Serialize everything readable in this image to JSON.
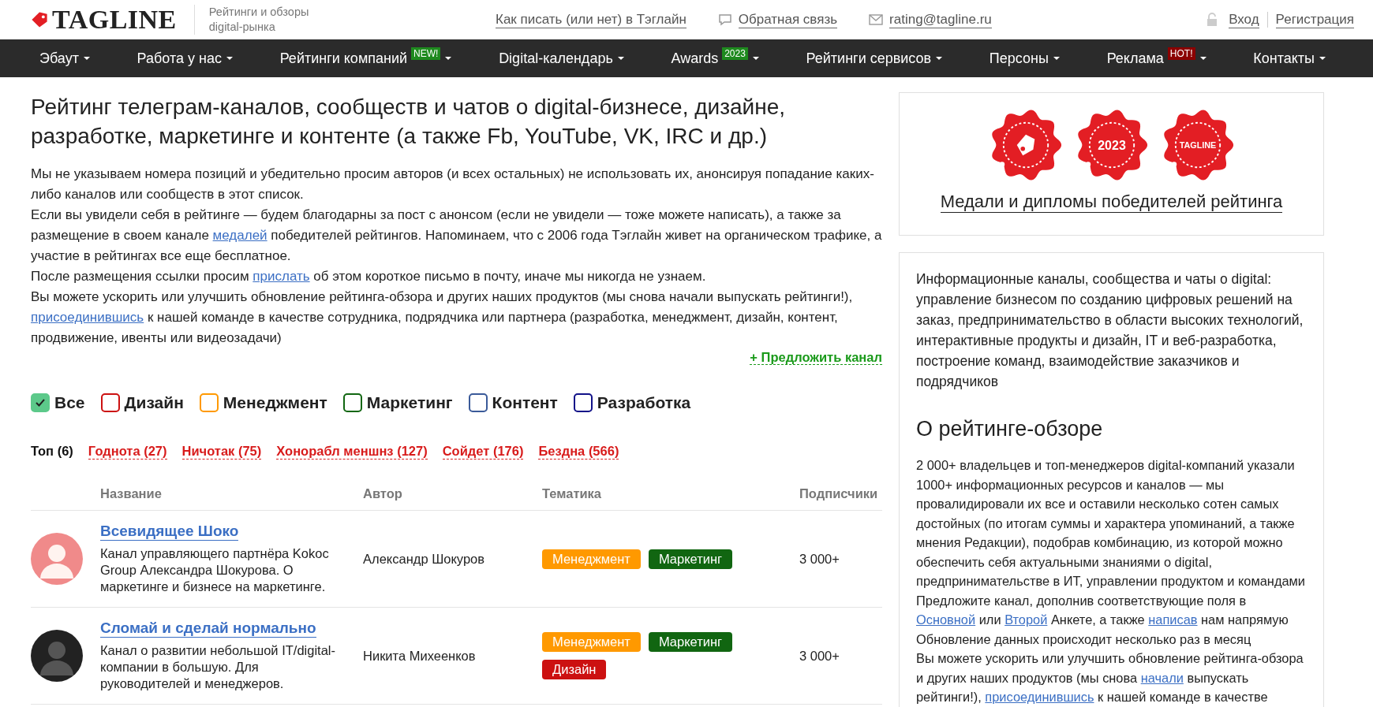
{
  "header": {
    "logo": "TAGLINE",
    "tagline": [
      "Рейтинги и обзоры",
      "digital-рынка"
    ],
    "links": [
      {
        "kind": "plain",
        "label": "Как писать (или нет) в Тэглайн"
      },
      {
        "kind": "chat",
        "label": "Обратная связь"
      },
      {
        "kind": "mail",
        "label": "rating@tagline.ru"
      }
    ],
    "login": "Вход",
    "register": "Регистрация"
  },
  "nav": [
    {
      "label": "Эбаут"
    },
    {
      "label": "Работа у нас"
    },
    {
      "label": "Рейтинги компаний",
      "badge": "NEW!",
      "color": "#1e8a1e"
    },
    {
      "label": "Digital-календарь"
    },
    {
      "label": "Awards",
      "badge": "2023",
      "color": "#1e8a1e"
    },
    {
      "label": "Рейтинги сервисов"
    },
    {
      "label": "Персоны"
    },
    {
      "label": "Реклама",
      "badge": "HOT!",
      "color": "#8b0000"
    },
    {
      "label": "Контакты"
    }
  ],
  "title": "Рейтинг телеграм-каналов, сообществ и чатов о digital-бизнесе, дизайне, разработке, маркетинге и контенте (а также Fb, YouTube, VK, IRC и др.)",
  "intro": [
    [
      {
        "text": "Мы не указываем номера позиций и убедительно просим авторов (и всех остальных) не использовать их, анонсируя попадание каких-либо каналов или сообществ в этот список."
      }
    ],
    [
      {
        "text": "Если вы увидели себя в рейтинге — будем благодарны за пост с анонсом (если не увидели — тоже можете написать), а также за размещение в своем канале "
      },
      {
        "link": "медалей"
      },
      {
        "text": " победителей рейтингов. Напоминаем, что с 2006 года Тэглайн живет на органическом трафике, а участие в рейтингах все еще бесплатное."
      }
    ],
    [
      {
        "text": "После размещения ссылки просим "
      },
      {
        "link": "прислать"
      },
      {
        "text": " об этом короткое письмо в почту, иначе мы никогда не узнаем."
      }
    ],
    [
      {
        "text": "Вы можете ускорить или улучшить обновление рейтинга-обзора и других наших продуктов (мы снова начали выпускать рейтинги!), "
      },
      {
        "link": "присоединившись"
      },
      {
        "text": " к нашей команде в качестве сотрудника, подрядчика или партнера (разработка, менеджмент, дизайн, контент, продвижение, ивенты или видеозадачи)"
      }
    ]
  ],
  "suggest": "+ Предложить канал",
  "filters": [
    {
      "label": "Все",
      "checked": true,
      "color": "#5cc98a"
    },
    {
      "label": "Дизайн",
      "checked": false,
      "color": "#cc1111"
    },
    {
      "label": "Менеджмент",
      "checked": false,
      "color": "#ff9900"
    },
    {
      "label": "Маркетинг",
      "checked": false,
      "color": "#116611"
    },
    {
      "label": "Контент",
      "checked": false,
      "color": "#3a5a99"
    },
    {
      "label": "Разработка",
      "checked": false,
      "color": "#111188"
    }
  ],
  "tabs": [
    {
      "label": "Топ (6)",
      "selected": true
    },
    {
      "label": "Годнота (27)",
      "selected": false
    },
    {
      "label": "Ничотак (75)",
      "selected": false
    },
    {
      "label": "Хонорабл меншнз (127)",
      "selected": false
    },
    {
      "label": "Сойдет (176)",
      "selected": false
    },
    {
      "label": "Бездна (566)",
      "selected": false
    }
  ],
  "table": {
    "columns": [
      "Название",
      "Автор",
      "Тематика",
      "Подписчики"
    ],
    "rows": [
      {
        "name": "Всевидящее Шоко",
        "description": "Канал управляющего партнёра Kokoc Group Александра Шокурова. О маркетинге и бизнесе на маркетинге.",
        "author": "Александр Шокуров",
        "tags": [
          {
            "label": "Менеджмент",
            "color": "#ff9900"
          },
          {
            "label": "Маркетинг",
            "color": "#116611"
          }
        ],
        "subscribers": "3 000+"
      },
      {
        "name": "Сломай и сделай нормально",
        "description": "Канал о развитии небольшой IT/digital-компании в большую. Для руководителей и менеджеров.",
        "author": "Никита Михеенков",
        "tags": [
          {
            "label": "Менеджмент",
            "color": "#ff9900"
          },
          {
            "label": "Маркетинг",
            "color": "#116611"
          },
          {
            "label": "Дизайн",
            "color": "#cc1111"
          }
        ],
        "subscribers": "3 000+"
      }
    ]
  },
  "medals": {
    "items": [
      {
        "kind": "tag"
      },
      {
        "kind": "year",
        "text": "2023"
      },
      {
        "kind": "brand",
        "text": "TAGLINE"
      }
    ],
    "caption": "Медали и дипломы победителей рейтинга"
  },
  "about": {
    "lead": "Информационные каналы, сообщества и чаты о digital: управление бизнесом по созданию цифровых решений на заказ, предпринимательство в области высоких технологий, интерактивные продукты и дизайн, IT и веб-разработка, построение команд, взаимодействие заказчиков и подрядчиков",
    "heading": "О рейтинге-обзоре",
    "paragraphs": [
      [
        {
          "text": "2 000+ владельцев и топ-менеджеров digital-компаний указали 1000+ информационных ресурсов и каналов — мы провалидировали их все и оставили несколько сотен самых достойных (по итогам суммы и характера упоминаний, а также мнения Редакции), подобрав комбинацию, из которой можно обеспечить себя актуальными знаниями о digital, предпринимательстве в ИТ, управлении продуктом и командами"
        }
      ],
      [
        {
          "text": "Предложите канал, дополнив соответствующие поля в "
        },
        {
          "link": "Основной"
        },
        {
          "text": " или "
        },
        {
          "link": "Второй"
        },
        {
          "text": " Анкете, а также "
        },
        {
          "link": "написав"
        },
        {
          "text": " нам напрямую"
        }
      ],
      [
        {
          "text": "Обновление данных происходит несколько раз в месяц"
        }
      ],
      [
        {
          "text": "Вы можете ускорить или улучшить обновление рейтинга-обзора и других наших продуктов (мы снова "
        },
        {
          "link": "начали"
        },
        {
          "text": " выпускать рейтинги!), "
        },
        {
          "link": "присоединившись"
        },
        {
          "text": " к нашей команде в качестве"
        }
      ]
    ]
  }
}
